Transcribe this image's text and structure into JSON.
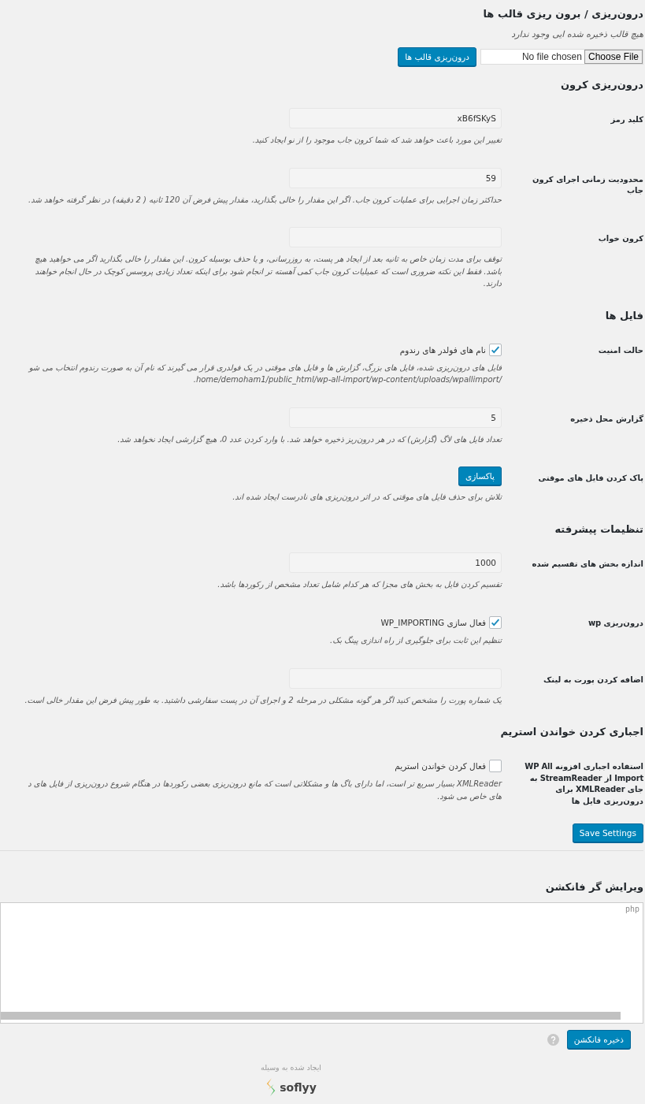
{
  "import_templates": {
    "title": "درون‌ریزی / برون ریزی قالب ها",
    "note": "هیچ قالب ذخیره شده ایی وجود ندارد",
    "file_button": "Choose File",
    "file_status": "No file chosen",
    "import_button": "درون‌ریزی قالب ها"
  },
  "sections": [
    {
      "title": "درون‌ریزی کرون",
      "rows": [
        {
          "kind": "text",
          "label": "کلید رمز",
          "value": "xB6fSKyS",
          "description": [
            "تغییر این مورد باعث خواهد شد که شما کرون جاب موجود را از نو ایجاد کنید."
          ]
        },
        {
          "kind": "text",
          "label": "محدودیت زمانی اجرای کرون جاب",
          "value": "59",
          "description": [
            "حداکثر زمان اجرایی برای عملیات کرون جاب. اگر این مقدار را خالی بگذارید، مقدار پیش فرض آن 120 ثانیه ( 2 دقیقه) در نظر گرفته خواهد شد."
          ]
        },
        {
          "kind": "text",
          "label": "کرون خواب",
          "description": [
            "توقف برای مدت زمان خاص به ثانیه بعد از ایجاد هر پست، به روزرسانی، و یا حذف بوسیله کرون. این مقدار را خالی بگذارید اگر می خواهید هیچ",
            "باشد. فقط این نکته ضروری است که عمیلیات کرون جاب کمی آهسته تر انجام شود برای اینکه تعداد زیادی پروسس کوچک در حال انجام خواهند",
            "دارند."
          ]
        }
      ]
    },
    {
      "title": "فایل ها",
      "rows": [
        {
          "kind": "checkbox",
          "label": "حالت امنیت",
          "checked": true,
          "option": "نام های فولدر های رندوم",
          "description": [
            "فایل های درون‌ریزی شده، فایل های بزرگ، گزارش ها و فایل های موقتی در یک فولدری قرار می گیرند که نام آن به صورت رندوم انتخاب می شو",
            "/home/demoham1/public_html/wp-all-import/wp-content/uploads/wpallimport."
          ]
        },
        {
          "kind": "text",
          "label": "گزارش محل ذخیره",
          "value": "5",
          "description": [
            "تعداد فایل های لاگ (گزارش) که در هر درون‌ریز ذخیره خواهد شد. با وارد کردن عدد 0، هیچ گزارشی ایجاد نخواهد شد."
          ]
        },
        {
          "kind": "button",
          "label": "پاک کردن فایل های موقتی",
          "button": "پاکسازی",
          "description": [
            "تلاش برای حذف فایل های موقتی که در اثر درون‌ریزی های نادرست ایجاد شده اند."
          ]
        }
      ]
    },
    {
      "title": "تنظیمات پیشرفته",
      "rows": [
        {
          "kind": "text",
          "label": "اندازه بخش های تقسیم شده",
          "value": "1000",
          "description": [
            "تقسیم کردن فایل به بخش های مجزا که هر کدام شامل تعداد مشخص از رکوردها باشد."
          ]
        },
        {
          "kind": "checkbox",
          "label": "درون‌ریزی wp",
          "checked": true,
          "option": "فعال سازی WP_IMPORTING",
          "description": [
            "تنظیم این ثابت برای جلوگیری از راه اندازی پینگ بک."
          ]
        },
        {
          "kind": "text",
          "label": "اضافه کردن پورت به لینک",
          "description": [
            "یک شماره پورت را مشخص کنید اگر هر گونه مشکلی در مرحله 2 و اجرای آن در پست سفارشی داشتید. به طور پیش فرض این مقدار خالی است."
          ]
        }
      ]
    },
    {
      "title": "اجباری کردن خواندن استریم",
      "rows": [
        {
          "kind": "checkbox",
          "label": "استفاده اجباری افزونه WP All Import از StreamReader به جای XMLReader برای درون‌ریزی فایل ها",
          "checked": false,
          "option": "فعال کردن خواندن استریم",
          "description": [
            "XMLReader بسیار سریع تر است، اما دارای باگ ها و مشکلاتی است که مانع درون‌ریزی بعضی رکوردها در هنگام شروع درون‌ریزی از فایل های د",
            "های خاص می شود."
          ]
        }
      ]
    }
  ],
  "save_button": "Save Settings",
  "function_editor": {
    "title": "ویرایش گر فانکشن",
    "code": "php",
    "save_button": "ذخیره فانکشن"
  },
  "footer": {
    "credit": "ایجاد شده به وسیله",
    "brand": "soflyy"
  }
}
